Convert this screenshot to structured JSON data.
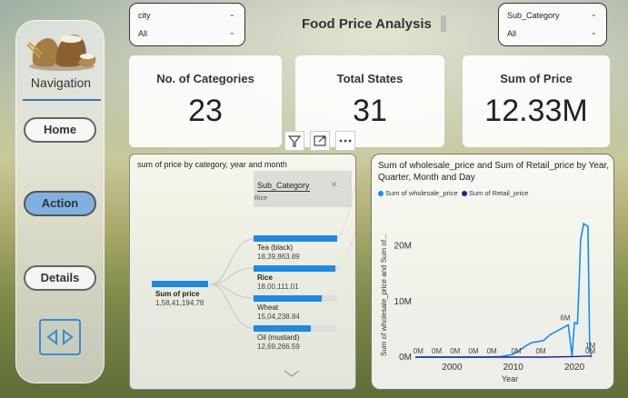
{
  "title": "Food Price Analysis",
  "slicers": {
    "city": {
      "label": "city",
      "value": "All"
    },
    "sub_category": {
      "label": "Sub_Category",
      "value": "All"
    }
  },
  "navigation": {
    "title": "Navigation",
    "buttons": [
      "Home",
      "Action",
      "Details"
    ],
    "active": "Action"
  },
  "cards": [
    {
      "label": "No. of Categories",
      "value": "23"
    },
    {
      "label": "Total States",
      "value": "31"
    },
    {
      "label": "Sum of Price",
      "value": "12.33M"
    }
  ],
  "decomposition": {
    "title": "sum of price by category, year and month",
    "filter_label": "Sub_Category",
    "filter_value": "Rice",
    "root": {
      "label": "Sum of price",
      "value": "1,58,41,194.78"
    },
    "items": [
      {
        "name": "Tea (black)",
        "value": "18,39,863.89",
        "fraction": 1.0,
        "bold": false
      },
      {
        "name": "Rice",
        "value": "18,00,111.01",
        "fraction": 0.98,
        "bold": true
      },
      {
        "name": "Wheat",
        "value": "15,04,238.84",
        "fraction": 0.82,
        "bold": false
      },
      {
        "name": "Oil (mustard)",
        "value": "12,69,266.59",
        "fraction": 0.69,
        "bold": false
      }
    ]
  },
  "line_chart": {
    "title": "Sum of wholesale_price and Sum of Retail_price by Year, Quarter, Month and Day",
    "legend": [
      "Sum of wholesale_price",
      "Sum of Retail_price"
    ],
    "y_axis_label": "Sum of wholesale_price and Sum of...",
    "x_axis_label": "Year",
    "x_ticks": [
      "2000",
      "2010",
      "2020"
    ],
    "y_ticks": [
      "0M",
      "10M",
      "20M"
    ],
    "colors": {
      "wholesale": "#118dff",
      "retail": "#12239e"
    }
  },
  "chart_data": {
    "type": "line",
    "title": "Sum of wholesale_price and Sum of Retail_price by Year, Quarter, Month and Day",
    "xlabel": "Year",
    "ylabel": "Sum of wholesale_price and Sum of...",
    "xlim": [
      1994,
      2024
    ],
    "ylim": [
      0,
      25
    ],
    "y_unit": "M",
    "x_ticks": [
      2000,
      2010,
      2020
    ],
    "y_ticks": [
      0,
      10,
      20
    ],
    "series": [
      {
        "name": "Sum of wholesale_price",
        "color": "#118dff",
        "points": [
          [
            1994,
            0
          ],
          [
            2000,
            0
          ],
          [
            2005,
            0
          ],
          [
            2008,
            0.1
          ],
          [
            2009,
            0.3
          ],
          [
            2010,
            0.5
          ],
          [
            2011,
            1.2
          ],
          [
            2012,
            2.0
          ],
          [
            2013,
            2.6
          ],
          [
            2014,
            2.8
          ],
          [
            2015,
            3.0
          ],
          [
            2016,
            4.0
          ],
          [
            2017,
            4.6
          ],
          [
            2018,
            5.2
          ],
          [
            2019,
            5.8
          ],
          [
            2019.6,
            0.2
          ],
          [
            2020,
            6.2
          ],
          [
            2020.5,
            6.0
          ],
          [
            2020.8,
            14.5
          ],
          [
            2021,
            21.0
          ],
          [
            2021.5,
            24.0
          ],
          [
            2022.2,
            23.5
          ],
          [
            2022.5,
            1.2
          ],
          [
            2022.8,
            0.3
          ]
        ],
        "data_labels": [
          {
            "x": 1994.5,
            "y": 0,
            "text": "0M"
          },
          {
            "x": 1997.5,
            "y": 0,
            "text": "0M"
          },
          {
            "x": 2000.5,
            "y": 0,
            "text": "0M"
          },
          {
            "x": 2003.5,
            "y": 0,
            "text": "0M"
          },
          {
            "x": 2006.5,
            "y": 0,
            "text": "0M"
          },
          {
            "x": 2010.5,
            "y": 0,
            "text": "0M"
          },
          {
            "x": 2014.5,
            "y": 0,
            "text": "0M"
          },
          {
            "x": 2018.5,
            "y": 6,
            "text": "6M"
          },
          {
            "x": 2022.6,
            "y": 1,
            "text": "1M"
          }
        ]
      },
      {
        "name": "Sum of Retail_price",
        "color": "#12239e",
        "points": [
          [
            1994,
            0
          ],
          [
            2000,
            0
          ],
          [
            2010,
            0
          ],
          [
            2015,
            0
          ],
          [
            2020,
            0.1
          ],
          [
            2022.6,
            0.2
          ],
          [
            2022.8,
            0
          ]
        ],
        "data_labels": [
          {
            "x": 2022.6,
            "y": 0,
            "text": "0M"
          }
        ]
      }
    ]
  }
}
